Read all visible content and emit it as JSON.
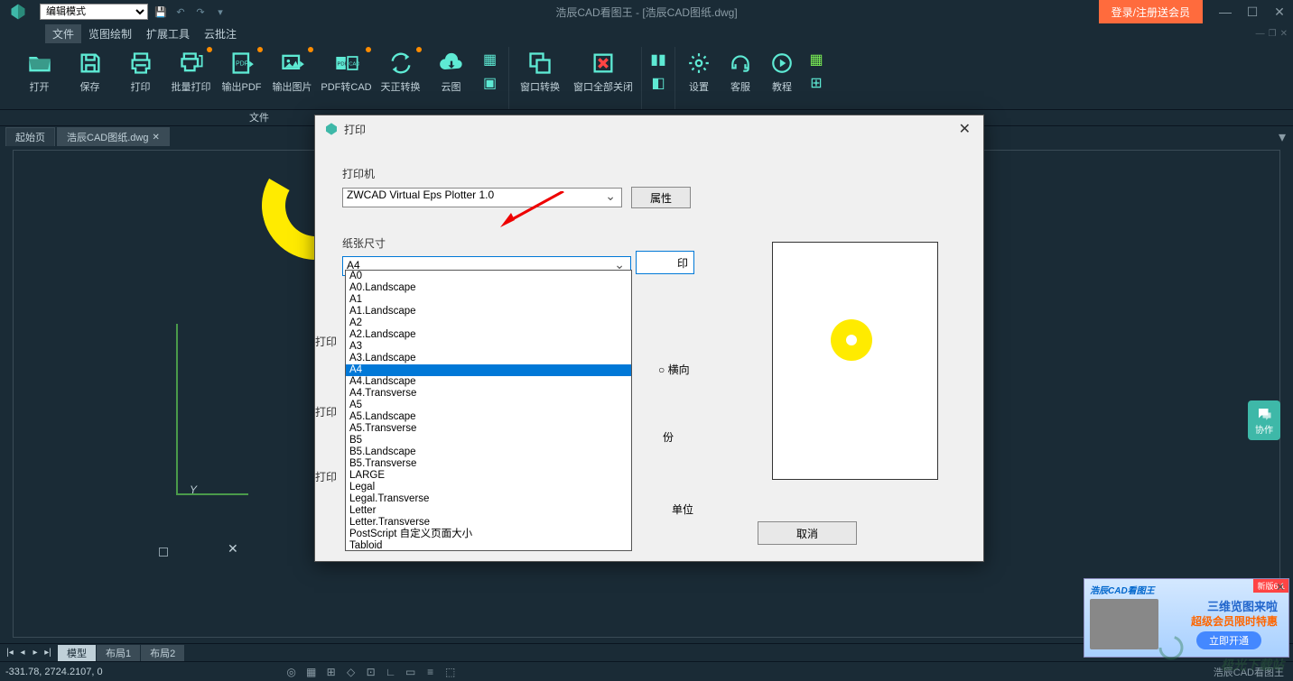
{
  "titlebar": {
    "mode": "编辑模式",
    "title": "浩辰CAD看图王 - [浩辰CAD图纸.dwg]",
    "login": "登录/注册送会员"
  },
  "menu": {
    "items": [
      "文件",
      "览图绘制",
      "扩展工具",
      "云批注"
    ]
  },
  "ribbon": {
    "btns": [
      "打开",
      "保存",
      "打印",
      "批量打印",
      "输出PDF",
      "输出图片",
      "PDF转CAD",
      "天正转换",
      "云图"
    ],
    "group1_label": "文件",
    "win_switch": "窗口转换",
    "win_close_all": "窗口全部关闭",
    "settings": "设置",
    "service": "客服",
    "tutorial": "教程"
  },
  "doc_tabs": {
    "start": "起始页",
    "file": "浩辰CAD图纸.dwg"
  },
  "dialog": {
    "title": "打印",
    "printer_label": "打印机",
    "printer_value": "ZWCAD Virtual Eps Plotter 1.0",
    "props_btn": "属性",
    "paper_label": "纸张尺寸",
    "paper_value": "A4",
    "print_sect1": "打印",
    "print_sect2": "打印",
    "print_sect3": "打印",
    "orient_h": "横向",
    "copies": "份",
    "unit": "单位",
    "ok_hint": "印",
    "cancel": "取消",
    "paper_options": [
      "A0",
      "A0.Landscape",
      "A1",
      "A1.Landscape",
      "A2",
      "A2.Landscape",
      "A3",
      "A3.Landscape",
      "A4",
      "A4.Landscape",
      "A4.Transverse",
      "A5",
      "A5.Landscape",
      "A5.Transverse",
      "B5",
      "B5.Landscape",
      "B5.Transverse",
      "LARGE",
      "Legal",
      "Legal.Transverse",
      "Letter",
      "Letter.Transverse",
      "PostScript 自定义页面大小",
      "Tabloid"
    ],
    "selected_option": "A4"
  },
  "bottom_tabs": [
    "模型",
    "布局1",
    "布局2"
  ],
  "statusbar": {
    "coords": "-331.78, 2724.2107, 0",
    "right": "浩辰CAD看图王"
  },
  "float_help": "协作",
  "promo": {
    "brand": "浩辰CAD看图王",
    "tag": "新版6.1",
    "line1": "三维览图来啦",
    "line2": "超级会员限时特惠",
    "btn": "立即开通"
  },
  "watermark": "极光下载站"
}
